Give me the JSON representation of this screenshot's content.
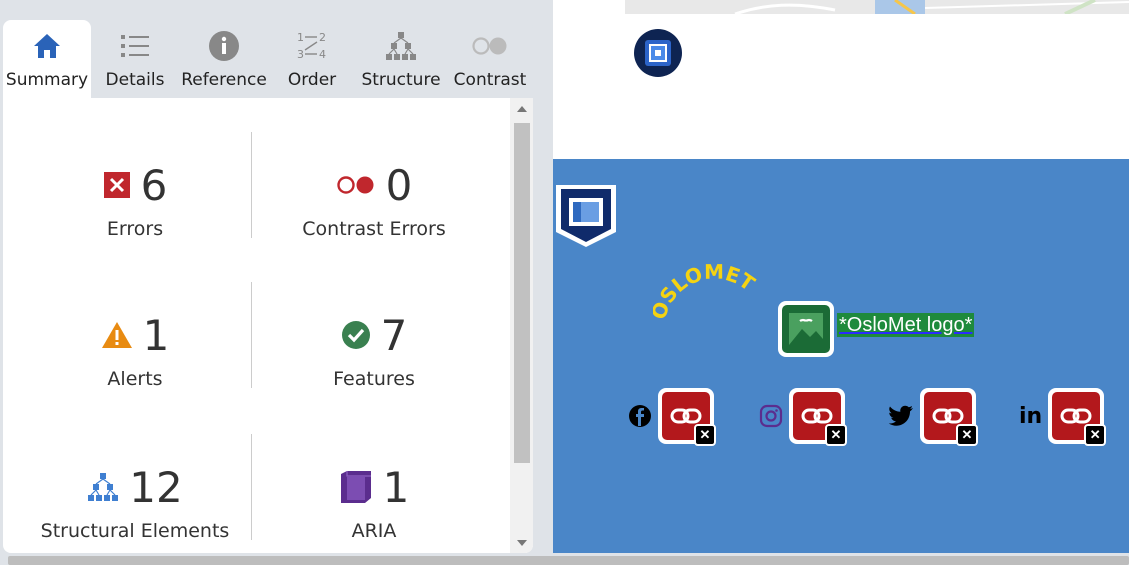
{
  "tabs": [
    {
      "label": "Summary",
      "icon": "home-icon",
      "active": true
    },
    {
      "label": "Details",
      "icon": "list-icon"
    },
    {
      "label": "Reference",
      "icon": "info-icon"
    },
    {
      "label": "Order",
      "icon": "order-icon"
    },
    {
      "label": "Structure",
      "icon": "hierarchy-icon"
    },
    {
      "label": "Contrast",
      "icon": "contrast-icon"
    }
  ],
  "summary": {
    "errors": {
      "count": "6",
      "label": "Errors",
      "icon": "error-icon",
      "color": "#c0272d"
    },
    "contrast": {
      "count": "0",
      "label": "Contrast Errors",
      "icon": "contrast-error-icon",
      "color": "#c0272d"
    },
    "alerts": {
      "count": "1",
      "label": "Alerts",
      "icon": "alert-triangle-icon",
      "color": "#e88b12"
    },
    "features": {
      "count": "7",
      "label": "Features",
      "icon": "check-circle-icon",
      "color": "#3a8050"
    },
    "structural": {
      "count": "12",
      "label": "Structural Elements",
      "icon": "hierarchy-icon",
      "color": "#3f7fd1"
    },
    "aria": {
      "count": "1",
      "label": "ARIA",
      "icon": "aria-cube-icon",
      "color": "#5b2d8e"
    }
  },
  "webpage": {
    "logo_alt": "*OsloMet logo*",
    "logo_text": "OSLOMET",
    "social": [
      "facebook-icon",
      "instagram-icon",
      "twitter-icon",
      "linkedin-icon"
    ],
    "linkedin_text": "in",
    "colors": {
      "background": "#4a86c8",
      "logo": "#f5d311",
      "alt_bg": "#1e8a3c"
    }
  }
}
